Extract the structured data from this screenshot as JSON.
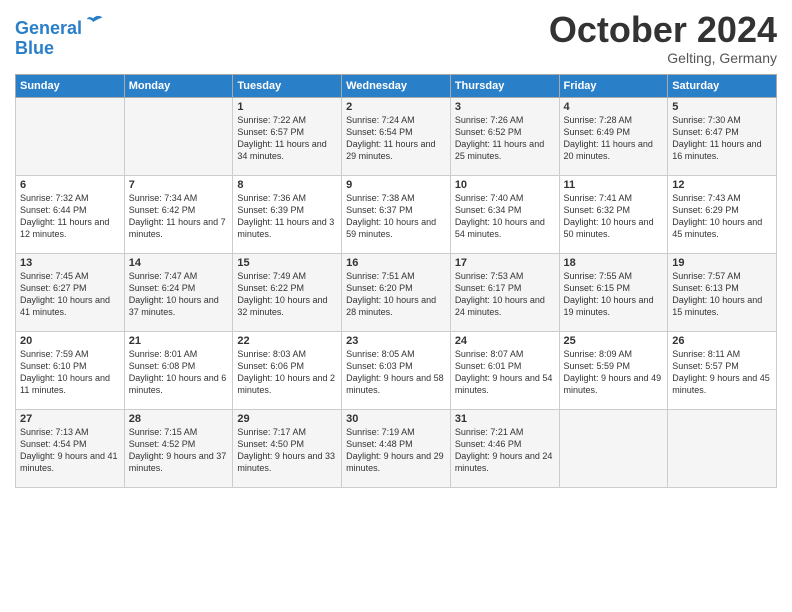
{
  "header": {
    "logo_line1": "General",
    "logo_line2": "Blue",
    "month": "October 2024",
    "location": "Gelting, Germany"
  },
  "days_of_week": [
    "Sunday",
    "Monday",
    "Tuesday",
    "Wednesday",
    "Thursday",
    "Friday",
    "Saturday"
  ],
  "weeks": [
    [
      {
        "day": "",
        "info": ""
      },
      {
        "day": "",
        "info": ""
      },
      {
        "day": "1",
        "info": "Sunrise: 7:22 AM\nSunset: 6:57 PM\nDaylight: 11 hours\nand 34 minutes."
      },
      {
        "day": "2",
        "info": "Sunrise: 7:24 AM\nSunset: 6:54 PM\nDaylight: 11 hours\nand 29 minutes."
      },
      {
        "day": "3",
        "info": "Sunrise: 7:26 AM\nSunset: 6:52 PM\nDaylight: 11 hours\nand 25 minutes."
      },
      {
        "day": "4",
        "info": "Sunrise: 7:28 AM\nSunset: 6:49 PM\nDaylight: 11 hours\nand 20 minutes."
      },
      {
        "day": "5",
        "info": "Sunrise: 7:30 AM\nSunset: 6:47 PM\nDaylight: 11 hours\nand 16 minutes."
      }
    ],
    [
      {
        "day": "6",
        "info": "Sunrise: 7:32 AM\nSunset: 6:44 PM\nDaylight: 11 hours\nand 12 minutes."
      },
      {
        "day": "7",
        "info": "Sunrise: 7:34 AM\nSunset: 6:42 PM\nDaylight: 11 hours\nand 7 minutes."
      },
      {
        "day": "8",
        "info": "Sunrise: 7:36 AM\nSunset: 6:39 PM\nDaylight: 11 hours\nand 3 minutes."
      },
      {
        "day": "9",
        "info": "Sunrise: 7:38 AM\nSunset: 6:37 PM\nDaylight: 10 hours\nand 59 minutes."
      },
      {
        "day": "10",
        "info": "Sunrise: 7:40 AM\nSunset: 6:34 PM\nDaylight: 10 hours\nand 54 minutes."
      },
      {
        "day": "11",
        "info": "Sunrise: 7:41 AM\nSunset: 6:32 PM\nDaylight: 10 hours\nand 50 minutes."
      },
      {
        "day": "12",
        "info": "Sunrise: 7:43 AM\nSunset: 6:29 PM\nDaylight: 10 hours\nand 45 minutes."
      }
    ],
    [
      {
        "day": "13",
        "info": "Sunrise: 7:45 AM\nSunset: 6:27 PM\nDaylight: 10 hours\nand 41 minutes."
      },
      {
        "day": "14",
        "info": "Sunrise: 7:47 AM\nSunset: 6:24 PM\nDaylight: 10 hours\nand 37 minutes."
      },
      {
        "day": "15",
        "info": "Sunrise: 7:49 AM\nSunset: 6:22 PM\nDaylight: 10 hours\nand 32 minutes."
      },
      {
        "day": "16",
        "info": "Sunrise: 7:51 AM\nSunset: 6:20 PM\nDaylight: 10 hours\nand 28 minutes."
      },
      {
        "day": "17",
        "info": "Sunrise: 7:53 AM\nSunset: 6:17 PM\nDaylight: 10 hours\nand 24 minutes."
      },
      {
        "day": "18",
        "info": "Sunrise: 7:55 AM\nSunset: 6:15 PM\nDaylight: 10 hours\nand 19 minutes."
      },
      {
        "day": "19",
        "info": "Sunrise: 7:57 AM\nSunset: 6:13 PM\nDaylight: 10 hours\nand 15 minutes."
      }
    ],
    [
      {
        "day": "20",
        "info": "Sunrise: 7:59 AM\nSunset: 6:10 PM\nDaylight: 10 hours\nand 11 minutes."
      },
      {
        "day": "21",
        "info": "Sunrise: 8:01 AM\nSunset: 6:08 PM\nDaylight: 10 hours\nand 6 minutes."
      },
      {
        "day": "22",
        "info": "Sunrise: 8:03 AM\nSunset: 6:06 PM\nDaylight: 10 hours\nand 2 minutes."
      },
      {
        "day": "23",
        "info": "Sunrise: 8:05 AM\nSunset: 6:03 PM\nDaylight: 9 hours\nand 58 minutes."
      },
      {
        "day": "24",
        "info": "Sunrise: 8:07 AM\nSunset: 6:01 PM\nDaylight: 9 hours\nand 54 minutes."
      },
      {
        "day": "25",
        "info": "Sunrise: 8:09 AM\nSunset: 5:59 PM\nDaylight: 9 hours\nand 49 minutes."
      },
      {
        "day": "26",
        "info": "Sunrise: 8:11 AM\nSunset: 5:57 PM\nDaylight: 9 hours\nand 45 minutes."
      }
    ],
    [
      {
        "day": "27",
        "info": "Sunrise: 7:13 AM\nSunset: 4:54 PM\nDaylight: 9 hours\nand 41 minutes."
      },
      {
        "day": "28",
        "info": "Sunrise: 7:15 AM\nSunset: 4:52 PM\nDaylight: 9 hours\nand 37 minutes."
      },
      {
        "day": "29",
        "info": "Sunrise: 7:17 AM\nSunset: 4:50 PM\nDaylight: 9 hours\nand 33 minutes."
      },
      {
        "day": "30",
        "info": "Sunrise: 7:19 AM\nSunset: 4:48 PM\nDaylight: 9 hours\nand 29 minutes."
      },
      {
        "day": "31",
        "info": "Sunrise: 7:21 AM\nSunset: 4:46 PM\nDaylight: 9 hours\nand 24 minutes."
      },
      {
        "day": "",
        "info": ""
      },
      {
        "day": "",
        "info": ""
      }
    ]
  ]
}
